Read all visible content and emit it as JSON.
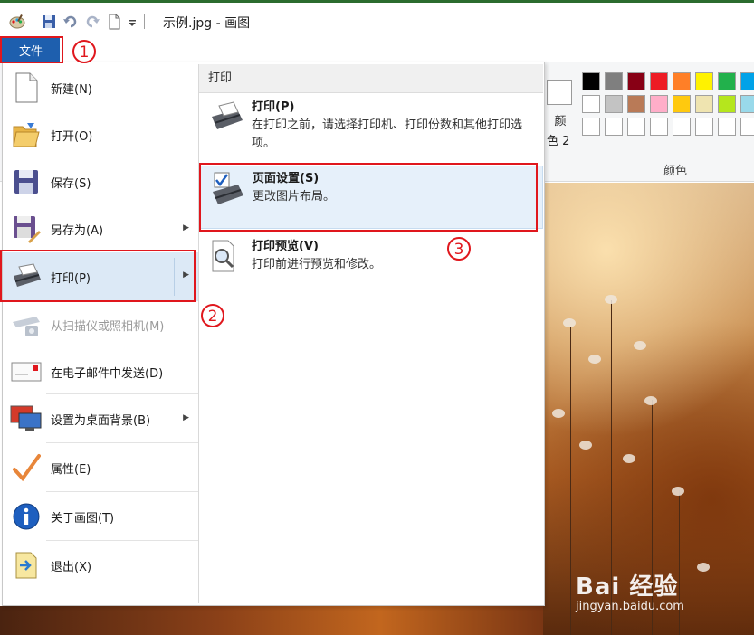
{
  "window": {
    "title": "示例.jpg - 画图"
  },
  "ribbon": {
    "file_tab": "文件",
    "color2_label_line1": "颜",
    "color2_label_line2": "色 2",
    "colors_group_label": "颜色",
    "palette_colors": [
      "#000000",
      "#7f7f7f",
      "#880015",
      "#ed1c24",
      "#ff7f27",
      "#fff200",
      "#22b14c",
      "#00a2e8",
      "#ffffff",
      "#c3c3c3",
      "#b97a57",
      "#ffaec9",
      "#ffc90e",
      "#efe4b0",
      "#b5e61d",
      "#99d9ea",
      "#ffffff",
      "#ffffff",
      "#ffffff",
      "#ffffff",
      "#ffffff",
      "#ffffff",
      "#ffffff",
      "#ffffff"
    ]
  },
  "file_menu": {
    "items": [
      {
        "label": "新建(N)",
        "icon": "new-file-icon"
      },
      {
        "label": "打开(O)",
        "icon": "open-folder-icon"
      },
      {
        "label": "保存(S)",
        "icon": "save-icon"
      },
      {
        "label": "另存为(A)",
        "icon": "save-as-icon",
        "submenu": true
      },
      {
        "label": "打印(P)",
        "icon": "printer-icon",
        "submenu": true,
        "active": true
      },
      {
        "label": "从扫描仪或照相机(M)",
        "icon": "scanner-icon",
        "disabled": true
      },
      {
        "label": "在电子邮件中发送(D)",
        "icon": "email-icon"
      },
      {
        "label": "设置为桌面背景(B)",
        "icon": "desktop-background-icon",
        "submenu": true
      },
      {
        "label": "属性(E)",
        "icon": "checkmark-icon"
      },
      {
        "label": "关于画图(T)",
        "icon": "info-icon"
      },
      {
        "label": "退出(X)",
        "icon": "exit-icon"
      }
    ],
    "submenu_arrow": "▶"
  },
  "print_panel": {
    "header": "打印",
    "items": [
      {
        "title": "打印(P)",
        "desc": "在打印之前，请选择打印机、打印份数和其他打印选项。",
        "icon": "printer-icon"
      },
      {
        "title": "页面设置(S)",
        "desc": "更改图片布局。",
        "icon": "page-setup-icon"
      },
      {
        "title": "打印预览(V)",
        "desc": "打印前进行预览和修改。",
        "icon": "print-preview-icon"
      }
    ]
  },
  "annotations": {
    "step1": "1",
    "step2": "2",
    "step3": "3"
  },
  "watermark": {
    "brand": "Bai 经验",
    "url": "jingyan.baidu.com"
  }
}
